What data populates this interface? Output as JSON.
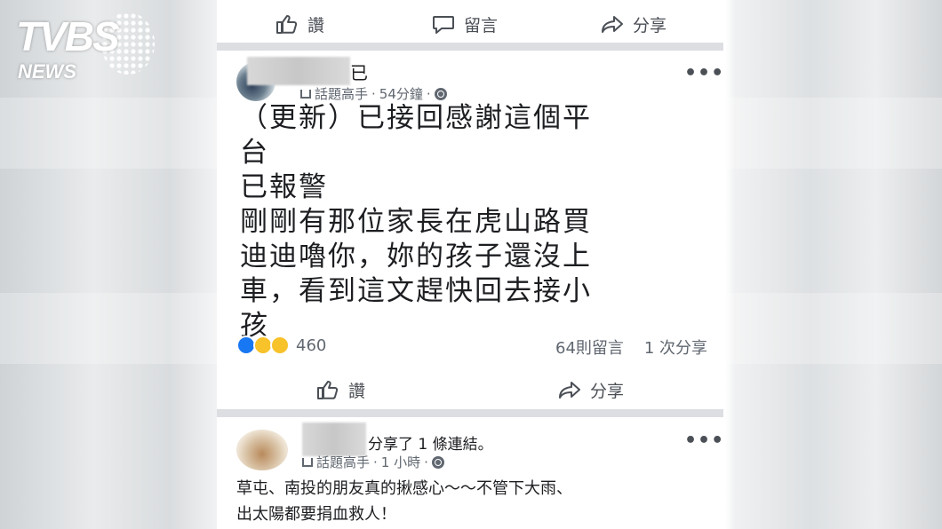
{
  "watermark": {
    "brand": "TVBS",
    "sub": "NEWS"
  },
  "top_actions": {
    "like": "讚",
    "comment": "留言",
    "share": "分享"
  },
  "post1": {
    "name_fragment": "已",
    "badge": "話題高手",
    "time": "54分鐘",
    "sep": "·",
    "more": "•••",
    "lines": [
      "（更新）已接回感謝這個平",
      "台",
      "已報警",
      "剛剛有那位家長在虎山路買",
      "迪迪嚕你，妳的孩子還沒上",
      "車，看到這文趕快回去接小",
      "孩"
    ],
    "reaction_count": "460",
    "comments": "64則留言",
    "shares": "1 次分享",
    "like": "讚",
    "share": "分享"
  },
  "post2": {
    "shared_text": "分享了 1 條連結。",
    "badge": "話題高手",
    "time": "1 小時",
    "sep": "·",
    "more": "•••",
    "lines": [
      "草屯、南投的朋友真的揪感心～～不管下大雨、",
      "出太陽都要捐血救人！"
    ]
  },
  "colors": {
    "icon": "#4b4f56",
    "meta": "#606770",
    "like_blue": "#1877f2",
    "divider": "#dcdee2"
  }
}
